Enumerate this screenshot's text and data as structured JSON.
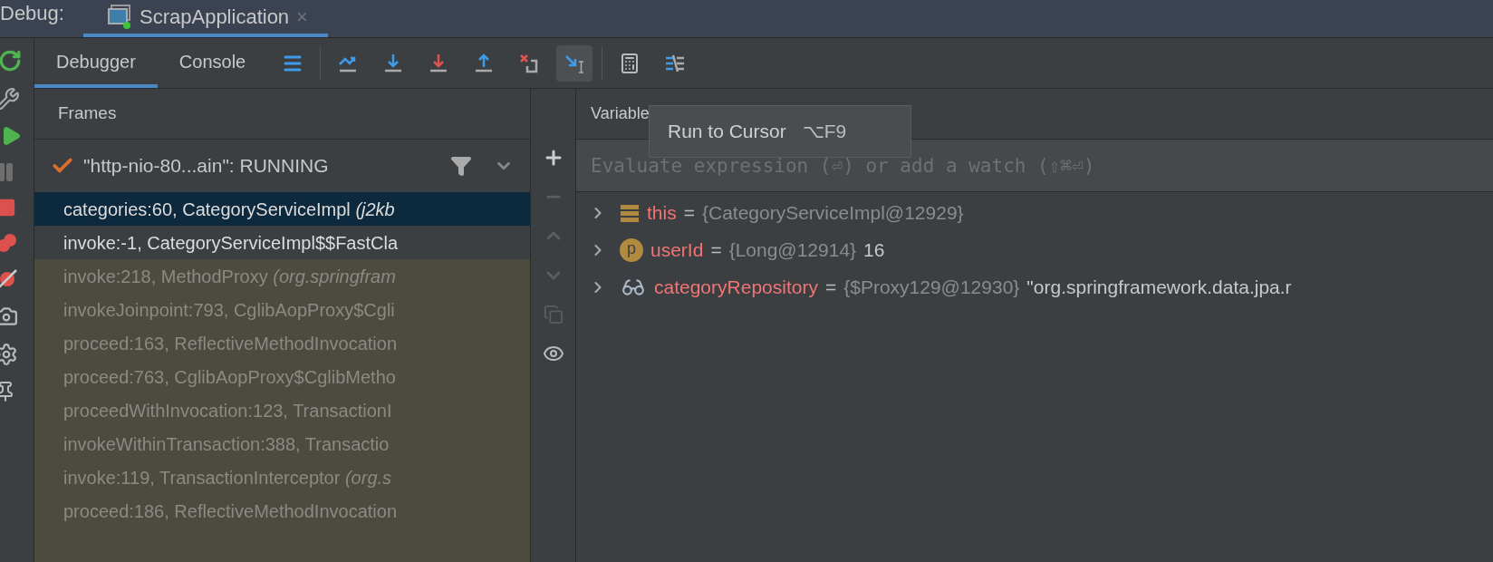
{
  "window": {
    "title": "Debug:",
    "tab": {
      "label": "ScrapApplication",
      "close": "×",
      "selected": true
    }
  },
  "toolbar": {
    "tabs": [
      {
        "label": "Debugger",
        "selected": true
      },
      {
        "label": "Console",
        "selected": false
      }
    ],
    "buttons": [
      {
        "kind": "menu",
        "highlighted": false
      },
      {
        "kind": "step-over",
        "highlighted": false
      },
      {
        "kind": "step-into",
        "highlighted": false
      },
      {
        "kind": "force-step-into",
        "highlighted": false
      },
      {
        "kind": "step-out",
        "highlighted": false
      },
      {
        "kind": "drop-frame",
        "highlighted": false
      },
      {
        "kind": "run-to-cursor",
        "highlighted": true
      },
      {
        "kind": "evaluate",
        "highlighted": false
      },
      {
        "kind": "trace",
        "highlighted": false
      }
    ]
  },
  "tooltip": {
    "label": "Run to Cursor",
    "shortcut": "⌥F9"
  },
  "frames": {
    "title": "Frames",
    "thread": "\"http-nio-80...ain\": RUNNING",
    "rows": [
      {
        "text": "categories:60, CategoryServiceImpl",
        "package": "(j2kb",
        "kind": "selected"
      },
      {
        "text": "invoke:-1, CategoryServiceImpl$$FastCla",
        "kind": "normal"
      },
      {
        "text": "invoke:218, MethodProxy",
        "package": "(org.springfram",
        "kind": "library"
      },
      {
        "text": "invokeJoinpoint:793, CglibAopProxy$Cgli",
        "kind": "library"
      },
      {
        "text": "proceed:163, ReflectiveMethodInvocation",
        "kind": "library"
      },
      {
        "text": "proceed:763, CglibAopProxy$CglibMetho",
        "kind": "library"
      },
      {
        "text": "proceedWithInvocation:123, TransactionI",
        "kind": "library"
      },
      {
        "text": "invokeWithinTransaction:388, Transactio",
        "kind": "library"
      },
      {
        "text": "invoke:119, TransactionInterceptor",
        "package": "(org.s",
        "kind": "library"
      },
      {
        "text": "proceed:186, ReflectiveMethodInvocation",
        "kind": "library"
      }
    ]
  },
  "variables": {
    "title": "Variable",
    "evaluate": {
      "placeholder": "Evaluate expression (⏎) or add a watch (⇧⌘⏎)"
    },
    "rows": [
      {
        "kind": "field",
        "name": "this",
        "eq": "=",
        "value": "{CategoryServiceImpl@12929}"
      },
      {
        "kind": "primitive",
        "badge": "p",
        "name": "userId",
        "eq": "=",
        "value": "{Long@12914}",
        "extra": "16"
      },
      {
        "kind": "watch",
        "name": "categoryRepository",
        "eq": "=",
        "value": "{$Proxy129@12930}",
        "extra": "\"org.springframework.data.jpa.r"
      }
    ]
  }
}
